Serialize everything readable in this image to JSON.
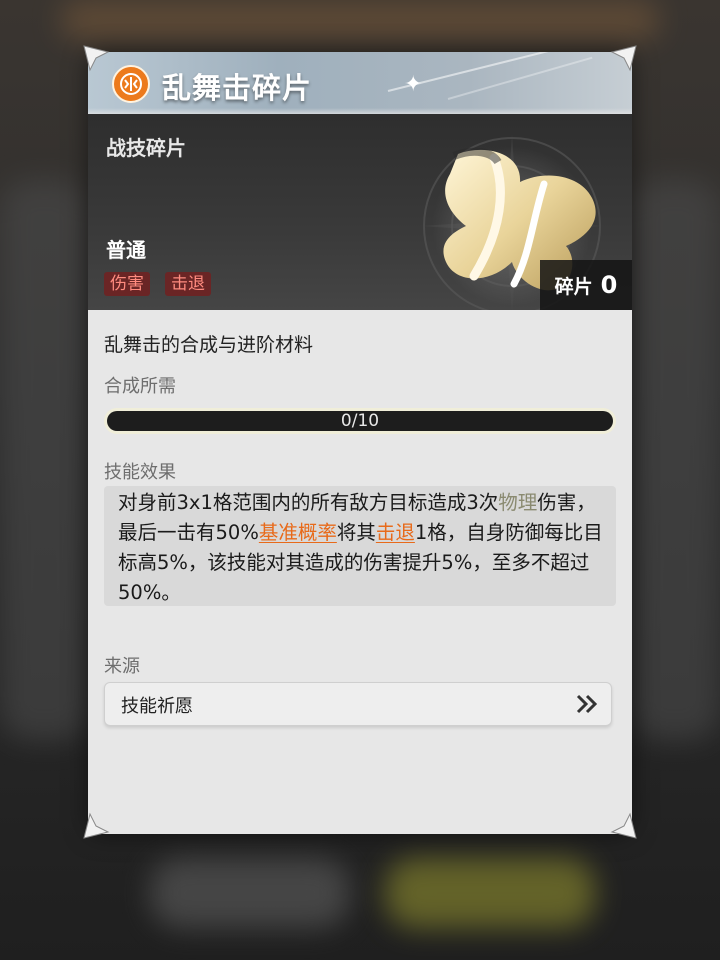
{
  "item": {
    "name": "乱舞击碎片",
    "category": "战技碎片",
    "rarity": "普通",
    "tags": [
      "伤害",
      "击退"
    ],
    "count_label": "碎片",
    "count_value": "0"
  },
  "material": {
    "description": "乱舞击的合成与进阶材料",
    "synth_label": "合成所需",
    "progress": {
      "current": 0,
      "total": 10,
      "text": "0/10"
    }
  },
  "effect": {
    "label": "技能效果",
    "segments": [
      "对身前3x1格范围内的所有敌方目标造成3次",
      "物理",
      "伤害，最后一击有50%",
      "基准概率",
      "将其",
      "击退",
      "1格，自身防御每比目标高5%，该技能对其造成的伤害提升5%，至多不超过50%。"
    ]
  },
  "source": {
    "label": "来源",
    "entry": "技能祈愿",
    "arrow_icon": "double-chevron-right-icon"
  },
  "colors": {
    "accent_orange": "#e86a1a",
    "tag_text": "#ff8b7f",
    "tag_bg": "#6a2525",
    "icon_orange": "#ec7a1c"
  }
}
